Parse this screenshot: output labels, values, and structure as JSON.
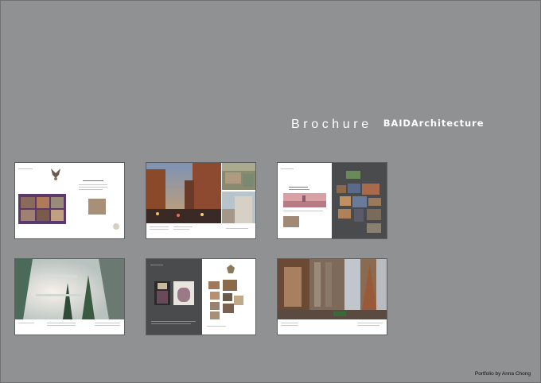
{
  "header": {
    "title_word1": "Brochure",
    "title_word2": "BAIDArchitecture"
  },
  "footer": {
    "credit": "Portfolio by Anna Chong"
  },
  "spreads": [
    {
      "row": 1,
      "col": 1,
      "label": ""
    },
    {
      "row": 1,
      "col": 2,
      "label": ""
    },
    {
      "row": 1,
      "col": 3,
      "label": ""
    },
    {
      "row": 2,
      "col": 1,
      "label": ""
    },
    {
      "row": 2,
      "col": 2,
      "label": ""
    },
    {
      "row": 2,
      "col": 3,
      "label": ""
    }
  ],
  "colors": {
    "background": "#8f9193",
    "page": "#ffffff",
    "accent_purple": "#5b3a6b",
    "dark_panel": "#4a4b4d"
  }
}
